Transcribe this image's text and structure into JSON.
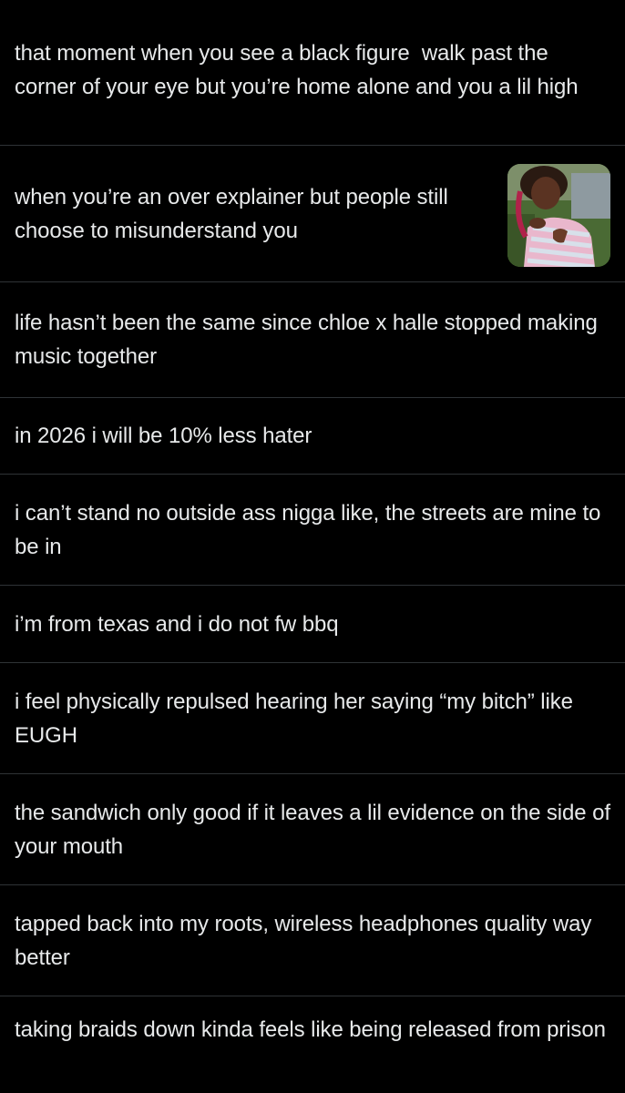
{
  "posts": [
    {
      "text": "that moment when you see a black figure  walk past the corner of your eye but you’re home alone and you a lil high"
    },
    {
      "text": "when you’re an over explainer but people still choose to misunderstand you",
      "thumbnail": "woman-in-pink-striped-tank-top-reaction-image"
    },
    {
      "text": "life hasn’t been the same since chloe x halle stopped making music together"
    },
    {
      "text": "in 2026 i will be 10% less hater"
    },
    {
      "text": "i can’t stand no outside ass nigga like, the streets are mine to be in"
    },
    {
      "text": "i’m from texas and i do not fw bbq"
    },
    {
      "text": "i feel physically repulsed hearing her saying “my bitch” like EUGH"
    },
    {
      "text": "the sandwich only good if it leaves a lil evidence on the side of your mouth"
    },
    {
      "text": "tapped back into my roots, wireless headphones quality way better"
    },
    {
      "text": "taking braids down kinda feels like being released from prison"
    }
  ],
  "colors": {
    "background": "#000000",
    "text": "#e7e9ea",
    "divider": "#2f3336"
  }
}
